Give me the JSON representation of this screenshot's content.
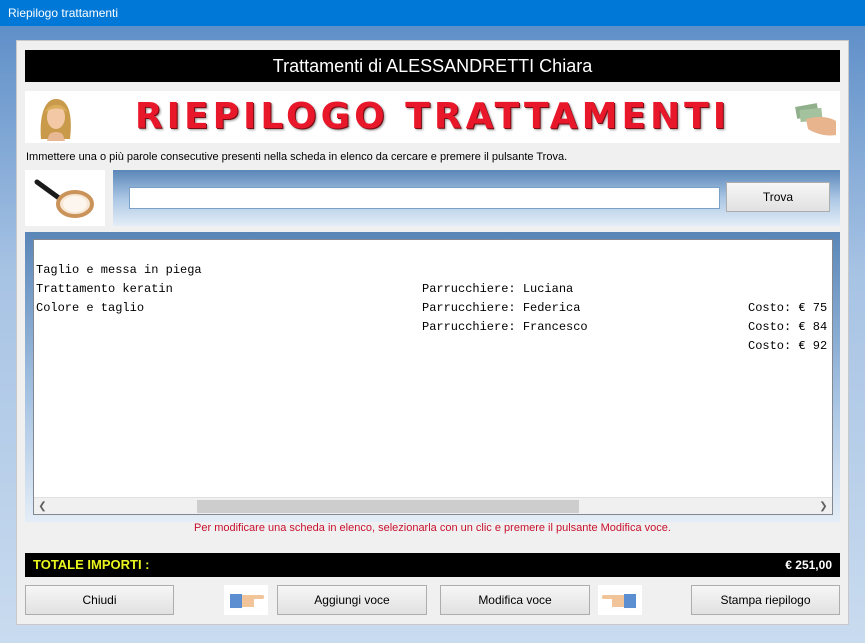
{
  "window": {
    "title": "Riepilogo trattamenti"
  },
  "header": {
    "title": "Trattamenti di ALESSANDRETTI Chiara"
  },
  "banner": {
    "title": "RIEPILOGO TRATTAMENTI"
  },
  "instructions": "Immettere una o più parole consecutive presenti nella scheda in elenco da cercare e premere il pulsante Trova.",
  "search": {
    "value": "",
    "button": "Trova"
  },
  "list": {
    "rows": [
      {
        "name": "Taglio e messa in piega",
        "hairdresser": "Parrucchiere: Luciana",
        "cost": "Costo: € 75"
      },
      {
        "name": "Trattamento keratin",
        "hairdresser": "Parrucchiere: Federica",
        "cost": "Costo: € 84"
      },
      {
        "name": "Colore e taglio",
        "hairdresser": "Parrucchiere: Francesco",
        "cost": "Costo: € 92"
      }
    ]
  },
  "hint": "Per modificare una scheda in elenco, selezionarla con un clic e premere il pulsante Modifica voce.",
  "total": {
    "label": "TOTALE IMPORTI :",
    "value": "€ 251,00"
  },
  "buttons": {
    "close": "Chiudi",
    "add": "Aggiungi voce",
    "edit": "Modifica voce",
    "print": "Stampa riepilogo"
  },
  "icons": {
    "avatar": "woman-portrait-icon",
    "money": "money-hand-icon",
    "magnifier": "magnifier-icon",
    "hand": "pointing-hand-icon"
  }
}
